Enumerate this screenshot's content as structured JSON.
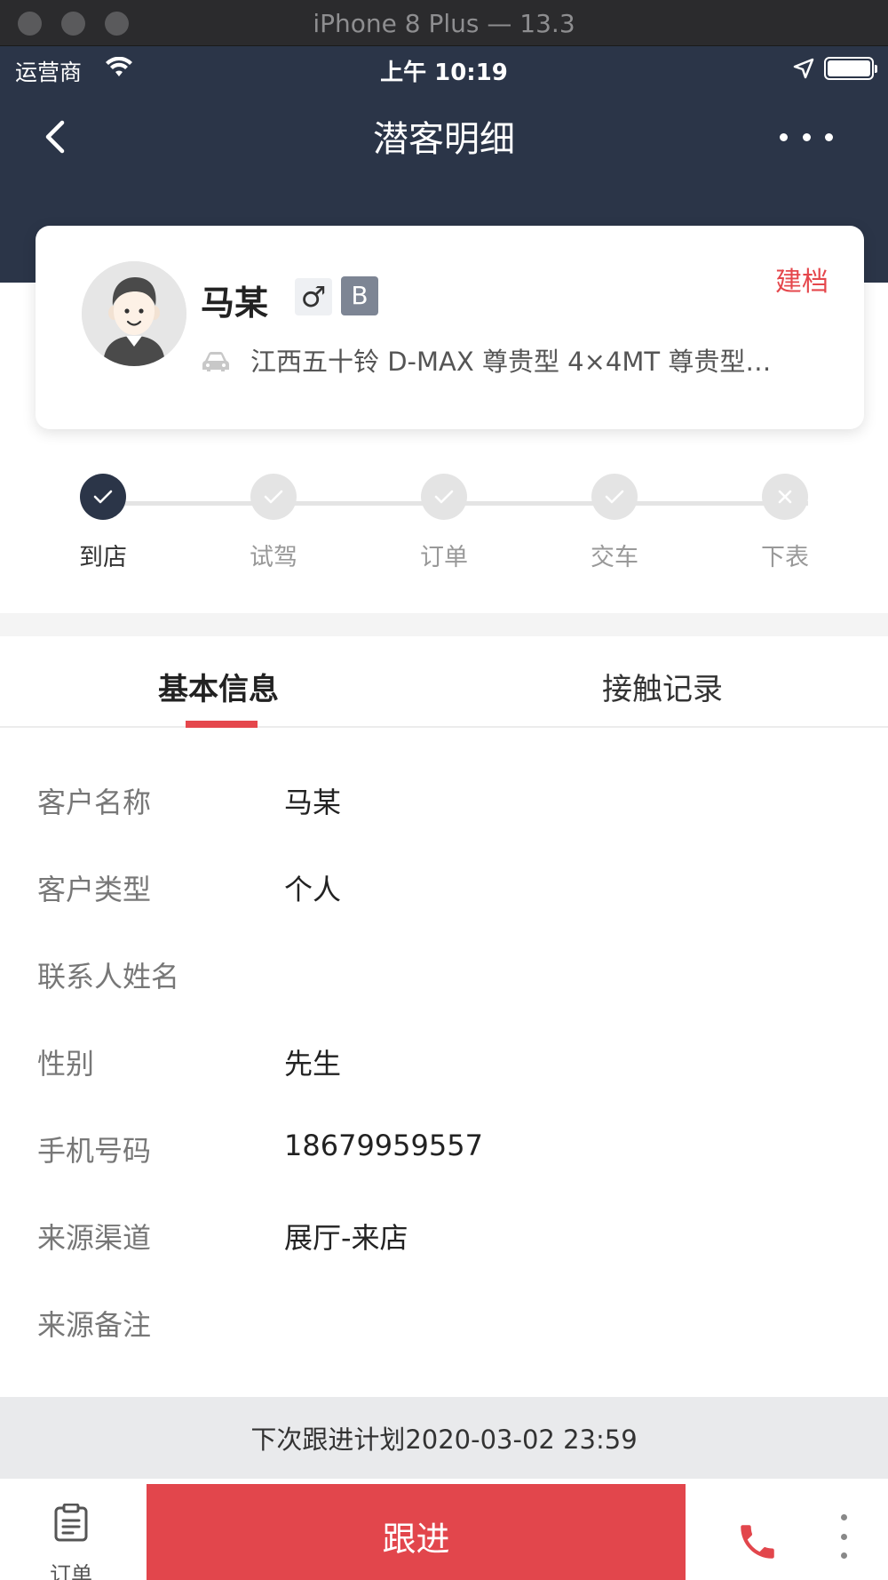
{
  "simulator": {
    "title": "iPhone 8 Plus — 13.3"
  },
  "status_bar": {
    "carrier": "运营商",
    "time": "上午 10:19"
  },
  "nav": {
    "title": "潜客明细"
  },
  "profile": {
    "name": "马某",
    "gender_symbol": "♂",
    "grade": "B",
    "action_label": "建档",
    "vehicle": "江西五十铃 D-MAX 尊贵型 4×4MT 尊贵型…"
  },
  "steps": [
    {
      "label": "到店",
      "state": "done"
    },
    {
      "label": "试驾",
      "state": "check"
    },
    {
      "label": "订单",
      "state": "check"
    },
    {
      "label": "交车",
      "state": "check"
    },
    {
      "label": "下表",
      "state": "cross"
    }
  ],
  "tabs": {
    "basic": "基本信息",
    "contact": "接触记录",
    "active": "basic"
  },
  "info": [
    {
      "label": "客户名称",
      "value": "马某"
    },
    {
      "label": "客户类型",
      "value": "个人"
    },
    {
      "label": "联系人姓名",
      "value": ""
    },
    {
      "label": "性别",
      "value": "先生"
    },
    {
      "label": "手机号码",
      "value": "18679959557"
    },
    {
      "label": "来源渠道",
      "value": "展厅-来店"
    },
    {
      "label": "来源备注",
      "value": ""
    }
  ],
  "plan": {
    "text": "下次跟进计划2020-03-02 23:59"
  },
  "bottom": {
    "order_label": "订单",
    "follow_label": "跟进"
  },
  "colors": {
    "header_bg": "#2b3548",
    "accent_red": "#e2464c",
    "grade_bg": "#7d8594"
  },
  "icons": [
    "back-chevron-icon",
    "more-dots-icon",
    "wifi-icon",
    "location-arrow-icon",
    "battery-icon",
    "car-icon",
    "check-icon",
    "close-icon",
    "order-list-icon",
    "phone-icon",
    "kebab-icon"
  ]
}
